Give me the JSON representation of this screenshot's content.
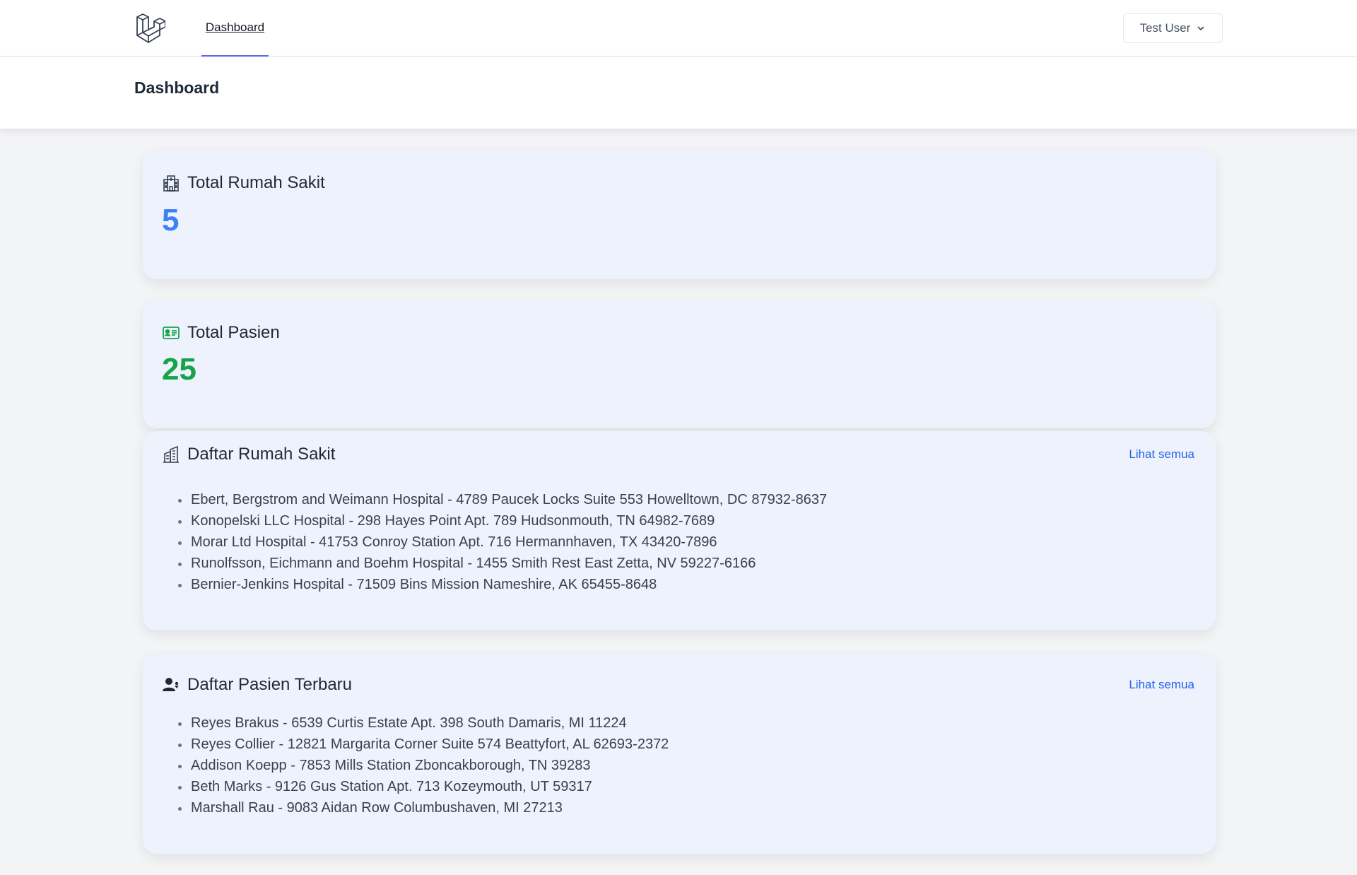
{
  "nav": {
    "logo_icon": "laravel-logo-icon",
    "dashboard_link": "Dashboard",
    "user_name": "Test User"
  },
  "header": {
    "title": "Dashboard"
  },
  "stats": {
    "hospitals": {
      "title": "Total Rumah Sakit",
      "value": "5",
      "icon": "hospital-icon",
      "color": "#3b82f6"
    },
    "patients": {
      "title": "Total Pasien",
      "value": "25",
      "icon": "id-card-icon",
      "color": "#16a34a"
    }
  },
  "hospital_list": {
    "title": "Daftar Rumah Sakit",
    "icon": "building-icon",
    "see_all": "Lihat semua",
    "items": [
      "Ebert, Bergstrom and Weimann Hospital - 4789 Paucek Locks Suite 553 Howelltown, DC 87932-8637",
      "Konopelski LLC Hospital - 298 Hayes Point Apt. 789 Hudsonmouth, TN 64982-7689",
      "Morar Ltd Hospital - 41753 Conroy Station Apt. 716 Hermannhaven, TX 43420-7896",
      "Runolfsson, Eichmann and Boehm Hospital - 1455 Smith Rest East Zetta, NV 59227-6166",
      "Bernier-Jenkins Hospital - 71509 Bins Mission Nameshire, AK 65455-8648"
    ]
  },
  "patient_list": {
    "title": "Daftar Pasien Terbaru",
    "icon": "user-icon",
    "see_all": "Lihat semua",
    "items": [
      "Reyes Brakus - 6539 Curtis Estate Apt. 398 South Damaris, MI 11224",
      "Reyes Collier - 12821 Margarita Corner Suite 574 Beattyfort, AL 62693-2372",
      "Addison Koepp - 7853 Mills Station Zboncakborough, TN 39283",
      "Beth Marks - 9126 Gus Station Apt. 713 Kozeymouth, UT 59317",
      "Marshall Rau - 9083 Aidan Row Columbushaven, MI 27213"
    ]
  }
}
